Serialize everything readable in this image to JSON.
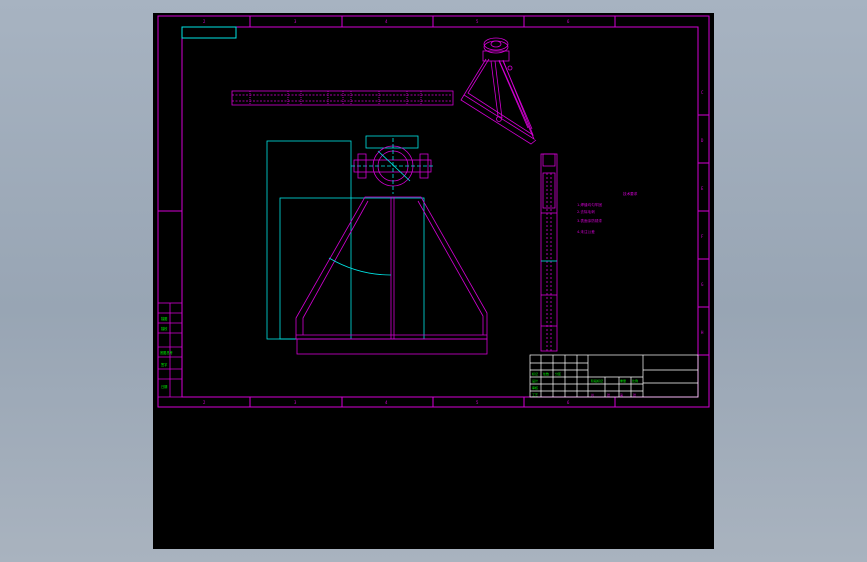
{
  "colors": {
    "background": "#000000",
    "frame": "#d400d4",
    "cyan": "#00e5e5",
    "green": "#00ff00",
    "white": "#ffffff",
    "desktop": "#a3afbd"
  },
  "border_zone_labels": {
    "top": [
      "2",
      "3",
      "4",
      "5",
      "6"
    ],
    "bottom": [
      "2",
      "3",
      "4",
      "5",
      "6"
    ],
    "right": [
      "C",
      "D",
      "E",
      "F",
      "G",
      "H"
    ]
  },
  "notes": {
    "heading": "技术要求",
    "lines": [
      "1.焊缝均匀牢固",
      "2.去除毛刺",
      "3.表面涂防锈漆",
      "4.未注公差"
    ]
  },
  "left_stamp": {
    "rows": [
      "描图",
      "描校",
      "底图总号",
      "签字",
      "日期"
    ]
  },
  "title_block": {
    "labels": [
      "标记",
      "处数",
      "分区",
      "设计",
      "审核",
      "工艺",
      "阶段标记",
      "重量",
      "比例",
      "共",
      "张",
      "第",
      "张"
    ]
  }
}
